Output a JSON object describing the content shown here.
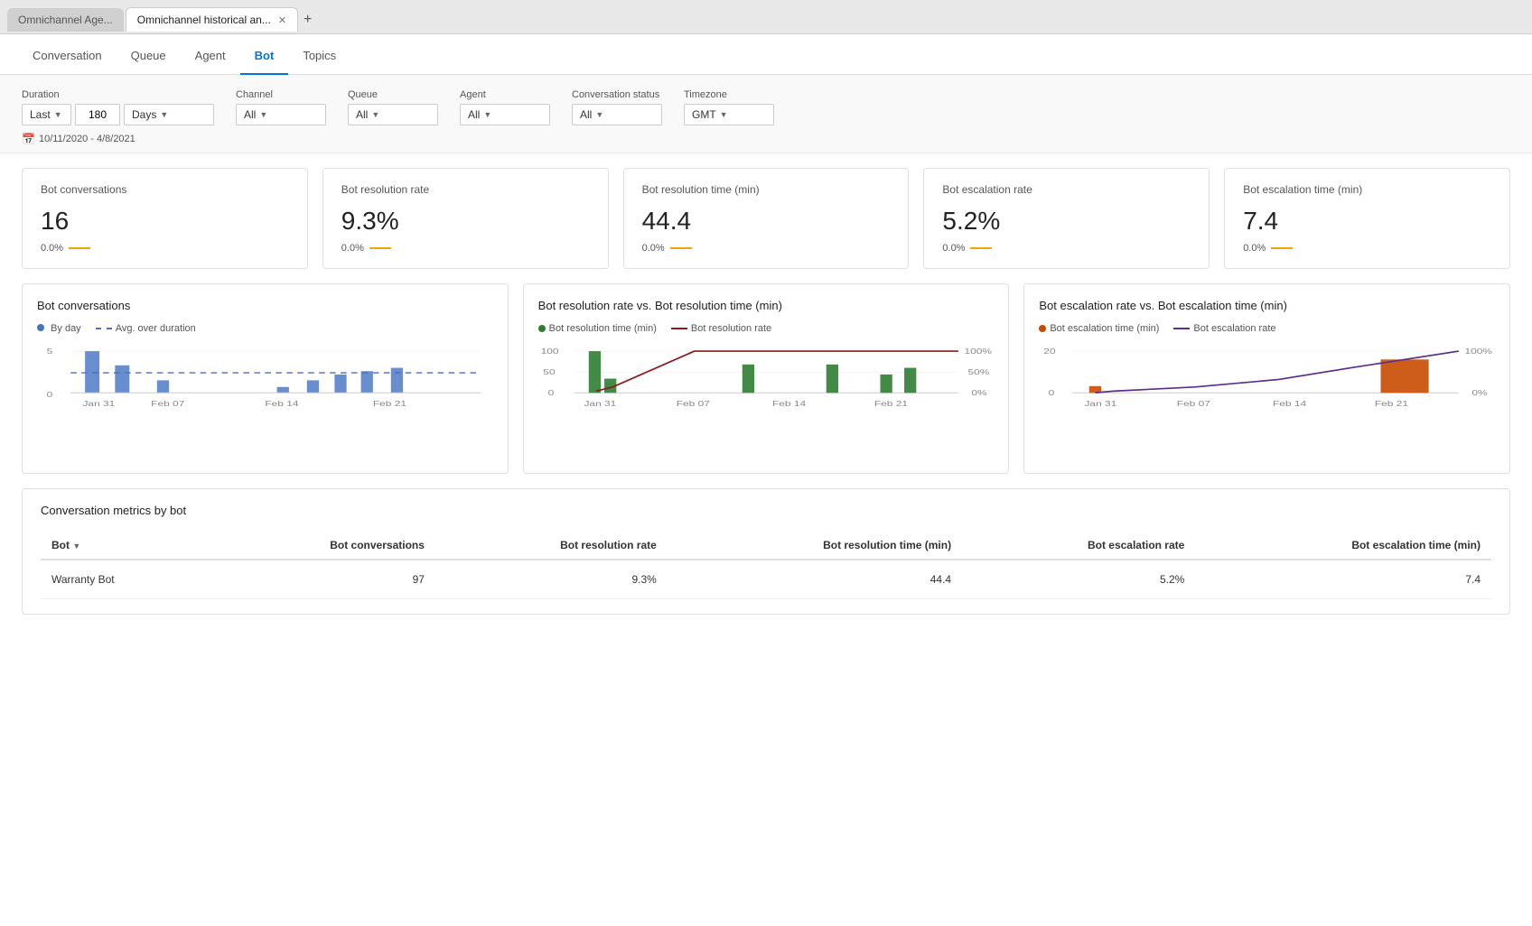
{
  "browser": {
    "tabs": [
      {
        "id": "tab1",
        "label": "Omnichannel Age...",
        "active": false
      },
      {
        "id": "tab2",
        "label": "Omnichannel historical an...",
        "active": true
      }
    ],
    "add_tab_label": "+"
  },
  "nav": {
    "tabs": [
      {
        "id": "conversation",
        "label": "Conversation"
      },
      {
        "id": "queue",
        "label": "Queue"
      },
      {
        "id": "agent",
        "label": "Agent"
      },
      {
        "id": "bot",
        "label": "Bot",
        "active": true
      },
      {
        "id": "topics",
        "label": "Topics"
      }
    ]
  },
  "filters": {
    "duration": {
      "label": "Duration",
      "preset": "Last",
      "value": "180",
      "unit": "Days"
    },
    "channel": {
      "label": "Channel",
      "value": "All"
    },
    "queue": {
      "label": "Queue",
      "value": "All"
    },
    "agent": {
      "label": "Agent",
      "value": "All"
    },
    "conversation_status": {
      "label": "Conversation status",
      "value": "All"
    },
    "timezone": {
      "label": "Timezone",
      "value": "GMT"
    },
    "date_range": "10/11/2020 - 4/8/2021"
  },
  "kpis": [
    {
      "id": "bot-conversations",
      "title": "Bot conversations",
      "value": "16",
      "change": "0.0%"
    },
    {
      "id": "bot-resolution-rate",
      "title": "Bot resolution rate",
      "value": "9.3%",
      "change": "0.0%"
    },
    {
      "id": "bot-resolution-time",
      "title": "Bot resolution time (min)",
      "value": "44.4",
      "change": "0.0%"
    },
    {
      "id": "bot-escalation-rate",
      "title": "Bot escalation rate",
      "value": "5.2%",
      "change": "0.0%"
    },
    {
      "id": "bot-escalation-time",
      "title": "Bot escalation time (min)",
      "value": "7.4",
      "change": "0.0%"
    }
  ],
  "charts": {
    "bot_conversations": {
      "title": "Bot conversations",
      "legend": [
        {
          "type": "dot",
          "color": "#4472c4",
          "label": "By day"
        },
        {
          "type": "dash",
          "color": "#4472c4",
          "label": "Avg. over duration"
        }
      ],
      "y_max": 5,
      "y_min": 0,
      "x_labels": [
        "Jan 31",
        "Feb 07",
        "Feb 14",
        "Feb 21"
      ],
      "avg_line": 2.5,
      "bars": [
        {
          "x": 0.08,
          "height": 0.95
        },
        {
          "x": 0.15,
          "height": 0.62
        },
        {
          "x": 0.27,
          "height": 0.28
        },
        {
          "x": 0.55,
          "height": 0.12
        },
        {
          "x": 0.63,
          "height": 0.28
        },
        {
          "x": 0.7,
          "height": 0.42
        },
        {
          "x": 0.77,
          "height": 0.48
        },
        {
          "x": 0.84,
          "height": 0.55
        }
      ]
    },
    "resolution_rate_vs_time": {
      "title": "Bot resolution rate vs. Bot resolution time (min)",
      "legend": [
        {
          "type": "dot",
          "color": "#2e7d32",
          "label": "Bot resolution time (min)"
        },
        {
          "type": "line",
          "color": "#8b1a1a",
          "label": "Bot resolution rate"
        }
      ],
      "y_left_max": 100,
      "y_right_max": "100%",
      "x_labels": [
        "Jan 31",
        "Feb 07",
        "Feb 14",
        "Feb 21"
      ]
    },
    "escalation_rate_vs_time": {
      "title": "Bot escalation rate vs. Bot escalation time (min)",
      "legend": [
        {
          "type": "dot",
          "color": "#c84b00",
          "label": "Bot escalation time (min)"
        },
        {
          "type": "line",
          "color": "#5b2d8e",
          "label": "Bot escalation rate"
        }
      ],
      "y_left_max": 20,
      "y_right_max": "100%",
      "x_labels": [
        "Jan 31",
        "Feb 07",
        "Feb 14",
        "Feb 21"
      ]
    }
  },
  "table": {
    "title": "Conversation metrics by bot",
    "columns": [
      {
        "id": "bot",
        "label": "Bot",
        "sortable": true
      },
      {
        "id": "bot-conversations",
        "label": "Bot conversations",
        "sortable": false
      },
      {
        "id": "bot-resolution-rate",
        "label": "Bot resolution rate",
        "sortable": false
      },
      {
        "id": "bot-resolution-time",
        "label": "Bot resolution time (min)",
        "sortable": false
      },
      {
        "id": "bot-escalation-rate",
        "label": "Bot escalation rate",
        "sortable": false
      },
      {
        "id": "bot-escalation-time",
        "label": "Bot escalation time (min)",
        "sortable": false
      }
    ],
    "rows": [
      {
        "bot": "Warranty Bot",
        "bot_conversations": "97",
        "bot_resolution_rate": "9.3%",
        "bot_resolution_time": "44.4",
        "bot_escalation_rate": "5.2%",
        "bot_escalation_time": "7.4"
      }
    ]
  }
}
